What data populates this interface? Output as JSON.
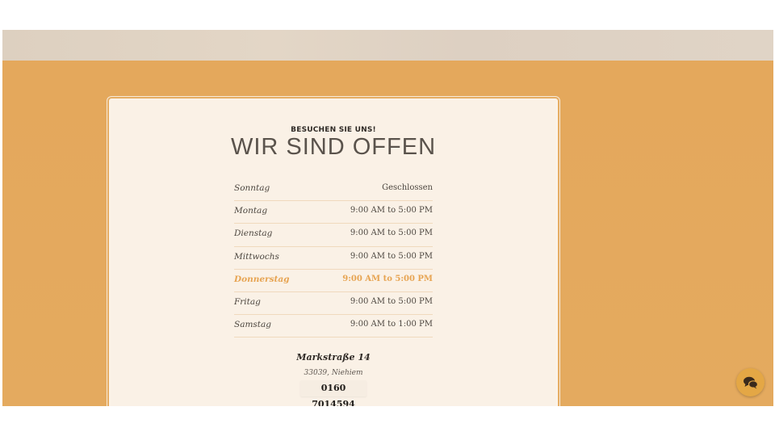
{
  "section": {
    "eyebrow": "BESUCHEN SIE UNS!",
    "heading": "WIR SIND OFFEN"
  },
  "hours": [
    {
      "day": "Sonntag",
      "time": "Geschlossen",
      "today": false
    },
    {
      "day": "Montag",
      "time": "9:00 AM to 5:00 PM",
      "today": false
    },
    {
      "day": "Dienstag",
      "time": "9:00 AM to 5:00 PM",
      "today": false
    },
    {
      "day": "Mittwochs",
      "time": "9:00 AM to 5:00 PM",
      "today": false
    },
    {
      "day": "Donnerstag",
      "time": "9:00 AM to 5:00 PM",
      "today": true
    },
    {
      "day": "Fritag",
      "time": "9:00 AM to 5:00 PM",
      "today": false
    },
    {
      "day": "Samstag",
      "time": "9:00 AM to 1:00 PM",
      "today": false
    }
  ],
  "address": {
    "street": "Markstraße 14",
    "city": "33039, Niehiem",
    "phone": "0160 7014594"
  },
  "chat": {
    "icon": "chat-bubbles-icon"
  },
  "colors": {
    "background": "#e5a85c",
    "card": "#faf1e6",
    "highlight": "#e7a452",
    "chat_button": "#e4a745"
  }
}
